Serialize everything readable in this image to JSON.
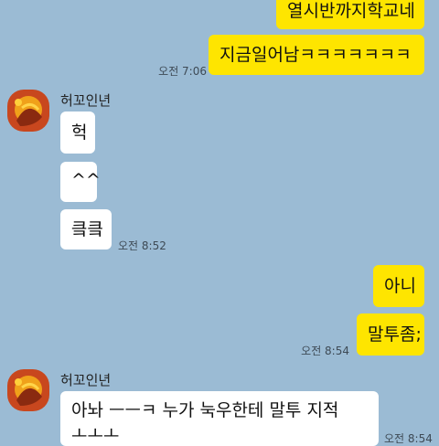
{
  "messages": [
    {
      "sender": "me",
      "text": "열시반까지학교네"
    },
    {
      "sender": "me",
      "text": "지금일어남ㅋㅋㅋㅋㅋㅋㅋ",
      "time": "오전 7:06"
    },
    {
      "sender": "other",
      "name": "허꼬인년",
      "text": "헉"
    },
    {
      "sender": "other",
      "text": "^^"
    },
    {
      "sender": "other",
      "text": "킄킄",
      "time": "오전 8:52"
    },
    {
      "sender": "me",
      "text": "아니"
    },
    {
      "sender": "me",
      "text": "말투좀;",
      "time": "오전 8:54"
    },
    {
      "sender": "other",
      "name": "허꼬인년",
      "text": "아놔 ㅡㅡㅋ 누가 눅우한테 말투 지적",
      "text_line2": "ㅗㅗㅗ",
      "time": "오전 8:54"
    }
  ],
  "colors": {
    "background": "#9bbbd4",
    "my_bubble": "#fee500",
    "other_bubble": "#ffffff"
  },
  "icons": {
    "avatar": "profile-avatar-orange-icon"
  }
}
